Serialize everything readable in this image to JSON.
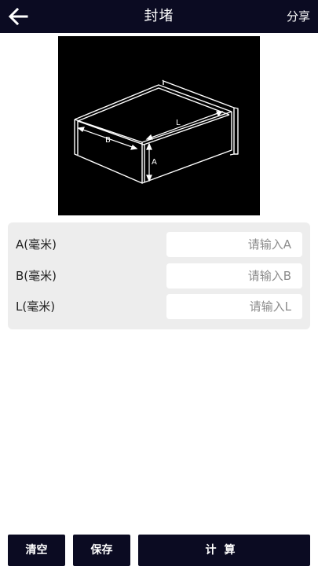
{
  "header": {
    "title": "封堵",
    "share_label": "分享",
    "back_icon": "arrow-left-icon"
  },
  "diagram": {
    "label_a": "A",
    "label_b": "B",
    "label_l": "L"
  },
  "form": {
    "fields": [
      {
        "label": "A(毫米)",
        "placeholder": "请输入A",
        "value": ""
      },
      {
        "label": "B(毫米)",
        "placeholder": "请输入B",
        "value": ""
      },
      {
        "label": "L(毫米)",
        "placeholder": "请输入L",
        "value": ""
      }
    ]
  },
  "actions": {
    "clear_label": "清空",
    "save_label": "保存",
    "calculate_label": "计算"
  },
  "colors": {
    "header_bg": "#0b0b22",
    "card_bg": "#ededed",
    "button_bg": "#0b0b22"
  }
}
